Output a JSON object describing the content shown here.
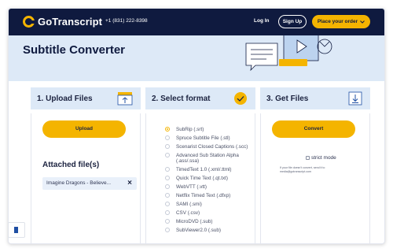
{
  "nav": {
    "logo_text": "GoTranscript",
    "phone": "+1 (831) 222-8398",
    "login": "Log In",
    "signup": "Sign Up",
    "order": "Place your order"
  },
  "hero": {
    "title": "Subtitle Converter"
  },
  "steps": {
    "upload": {
      "title": "1. Upload Files",
      "button": "Upload",
      "attached_title": "Attached file(s)",
      "file_name": "Imagine Dragons - Believe..."
    },
    "format": {
      "title": "2. Select format"
    },
    "get": {
      "title": "3. Get Files",
      "button": "Convert",
      "strict_label": "strict mode",
      "note": "If your file doesn't convert, send it to media@gotranscript.com"
    }
  },
  "formats": [
    {
      "label": "SubRip (.srt)",
      "selected": true
    },
    {
      "label": "Spruce Subtitle File (.stl)",
      "selected": false
    },
    {
      "label": "Scenarist Closed Captions (.scc)",
      "selected": false
    },
    {
      "label": "Advanced Sub Station Alpha (.ass/.ssa)",
      "selected": false
    },
    {
      "label": "TimedText 1.0 (.xml/.ttml)",
      "selected": false
    },
    {
      "label": "Quick Time Text (.qt.txt)",
      "selected": false
    },
    {
      "label": "WebVTT (.vtt)",
      "selected": false
    },
    {
      "label": "Netflix Timed Text (.dfxp)",
      "selected": false
    },
    {
      "label": "SAMI (.smi)",
      "selected": false
    },
    {
      "label": "CSV (.csv)",
      "selected": false
    },
    {
      "label": "MicroDVD (.sub)",
      "selected": false
    },
    {
      "label": "SubViewer2.0 (.sub)",
      "selected": false
    }
  ],
  "colors": {
    "navy": "#0f1a3f",
    "accent": "#f4b400",
    "panel": "#dde9f7"
  },
  "icons": {
    "upload": "upload-tray-icon",
    "format": "check-circle-icon",
    "download": "download-icon",
    "order": "chevron-down-icon"
  }
}
